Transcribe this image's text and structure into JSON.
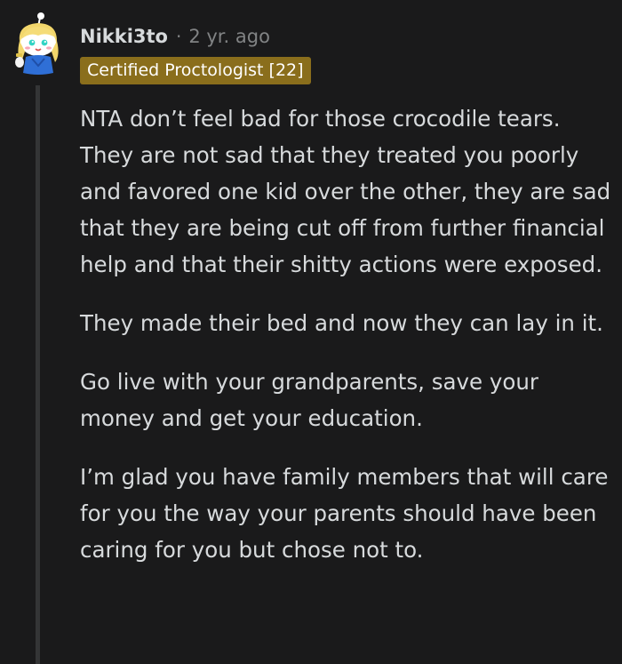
{
  "comment": {
    "author": "Nikki3to",
    "separator": "·",
    "timestamp": "2 yr. ago",
    "flair": "Certified Proctologist [22]",
    "avatar_icon": "snoo-avatar-icon",
    "paragraphs": [
      "NTA don’t feel bad for those crocodile tears. They are not sad that they treated you poorly and favored one kid over the other, they are sad that they are being cut off from further financial help and that their shitty actions were exposed.",
      "They made their bed and now they can lay in it.",
      "Go live with your grandparents, save your money and get your education.",
      "I’m glad you have family members that will care for you the way your parents should have been caring for you but chose not to."
    ]
  },
  "colors": {
    "background": "#1a1a1b",
    "text": "#d7dadc",
    "meta": "#818384",
    "flair_background": "#8a6e1c",
    "thread_line": "#343536"
  }
}
